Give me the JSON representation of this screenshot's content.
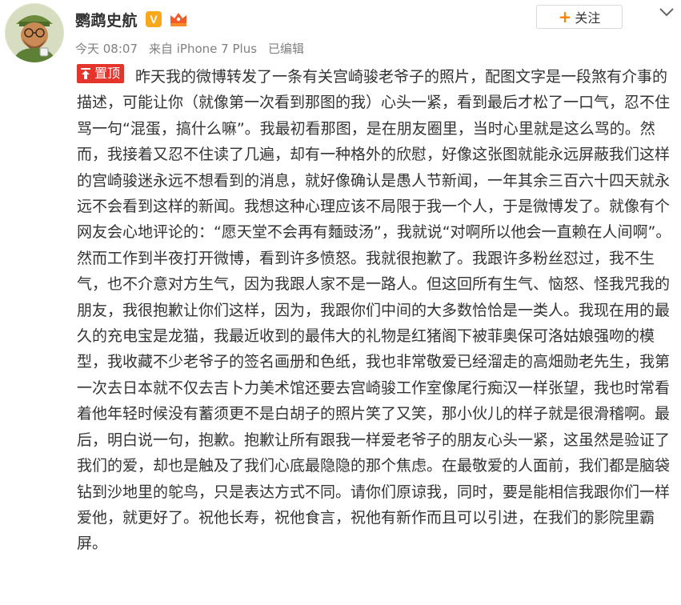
{
  "post": {
    "author": {
      "name": "鹦鹉史航"
    },
    "badges": {
      "verified": "V"
    },
    "meta": {
      "time": "今天 08:07",
      "source": "来自 iPhone 7 Plus",
      "edited": "已编辑"
    },
    "follow_label": "关注",
    "pin_label": "置顶",
    "body": "昨天我的微博转发了一条有关宫崎骏老爷子的照片，配图文字是一段煞有介事的描述，可能让你（就像第一次看到那图的我）心头一紧，看到最后才松了一口气，忍不住骂一句“混蛋，搞什么嘛”。我最初看那图，是在朋友圈里，当时心里就是这么骂的。然而，我接着又忍不住读了几遍，却有一种格外的欣慰，好像这张图就能永远屏蔽我们这样的宫崎骏迷永远不想看到的消息，就好像确认是愚人节新闻，一年其余三百六十四天就永远不会看到这样的新闻。我想这种心理应该不局限于我一个人，于是微博发了。就像有个网友会心地评论的：“愿天堂不会再有麵豉汤”，我就说“对啊所以他会一直赖在人间啊”。然而工作到半夜打开微博，看到许多愤怒。我就很抱歉了。我跟许多粉丝怼过，我不生气，也不介意对方生气，因为我跟人家不是一路人。但这回所有生气、恼怒、怪我咒我的朋友，我很抱歉让你们这样，因为，我跟你们中间的大多数恰恰是一类人。我现在用的最久的充电宝是龙猫，我最近收到的最伟大的礼物是红猪阁下被菲奥保可洛姑娘强吻的模型，我收藏不少老爷子的签名画册和色纸，我也非常敬爱已经溜走的高畑勋老先生，我第一次去日本就不仅去吉卜力美术馆还要去宫崎骏工作室像尾行痴汉一样张望，我也时常看着他年轻时候没有蓄须更不是白胡子的照片笑了又笑，那小伙儿的样子就是很滑稽啊。最后，明白说一句，抱歉。抱歉让所有跟我一样爱老爷子的朋友心头一紧，这虽然是验证了我们的爱，却也是触及了我们心底最隐隐的那个焦虑。在最敬爱的人面前，我们都是脑袋钻到沙地里的鸵鸟，只是表达方式不同。请你们原谅我，同时，要是能相信我跟你们一样爱他，就更好了。祝他长寿，祝他食言，祝他有新作而且可以引进，在我们的影院里霸屏。"
  },
  "colors": {
    "accent": "#ff8200",
    "pin": "#e5342b",
    "verified": "#f7a81b",
    "meta_text": "#808080",
    "body_text": "#333333"
  },
  "icons": {
    "avatar": "avatar-illustration",
    "verified": "verified-v-icon",
    "member": "member-crown-icon",
    "follow": "plus-icon",
    "menu": "chevron-down-icon",
    "pin": "pin-top-icon"
  }
}
